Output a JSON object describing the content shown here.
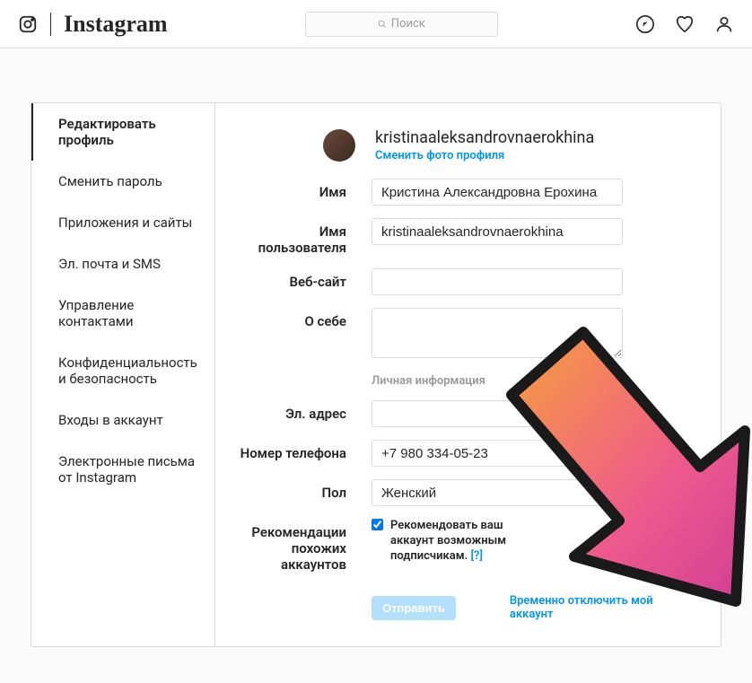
{
  "header": {
    "wordmark": "Instagram",
    "search_placeholder": "Поиск"
  },
  "sidebar": {
    "items": [
      {
        "label": "Редактировать профиль",
        "active": true
      },
      {
        "label": "Сменить пароль",
        "active": false
      },
      {
        "label": "Приложения и сайты",
        "active": false
      },
      {
        "label": "Эл. почта и SMS",
        "active": false
      },
      {
        "label": "Управление контактами",
        "active": false
      },
      {
        "label": "Конфиденциальность и безопасность",
        "active": false
      },
      {
        "label": "Входы в аккаунт",
        "active": false
      },
      {
        "label": "Электронные письма от Instagram",
        "active": false
      }
    ]
  },
  "profile": {
    "username": "kristinaaleksandrovnaerokhina",
    "change_photo_label": "Сменить фото профиля"
  },
  "form": {
    "name_label": "Имя",
    "name_value": "Кристина Александровна Ерохина",
    "username_label": "Имя пользователя",
    "username_value": "kristinaaleksandrovnaerokhina",
    "website_label": "Веб-сайт",
    "website_value": "",
    "bio_label": "О себе",
    "bio_value": "",
    "private_header": "Личная информация",
    "email_label": "Эл. адрес",
    "email_value": "",
    "phone_label": "Номер телефона",
    "phone_value": "+7 980 334-05-23",
    "gender_label": "Пол",
    "gender_value": "Женский",
    "similar_label": "Рекомендации похожих аккаунтов",
    "similar_checkbox_text": "Рекомендовать ваш аккаунт возможным подписчикам.",
    "similar_help": "[?]",
    "submit_label": "Отправить",
    "disable_label": "Временно отключить мой аккаунт"
  }
}
